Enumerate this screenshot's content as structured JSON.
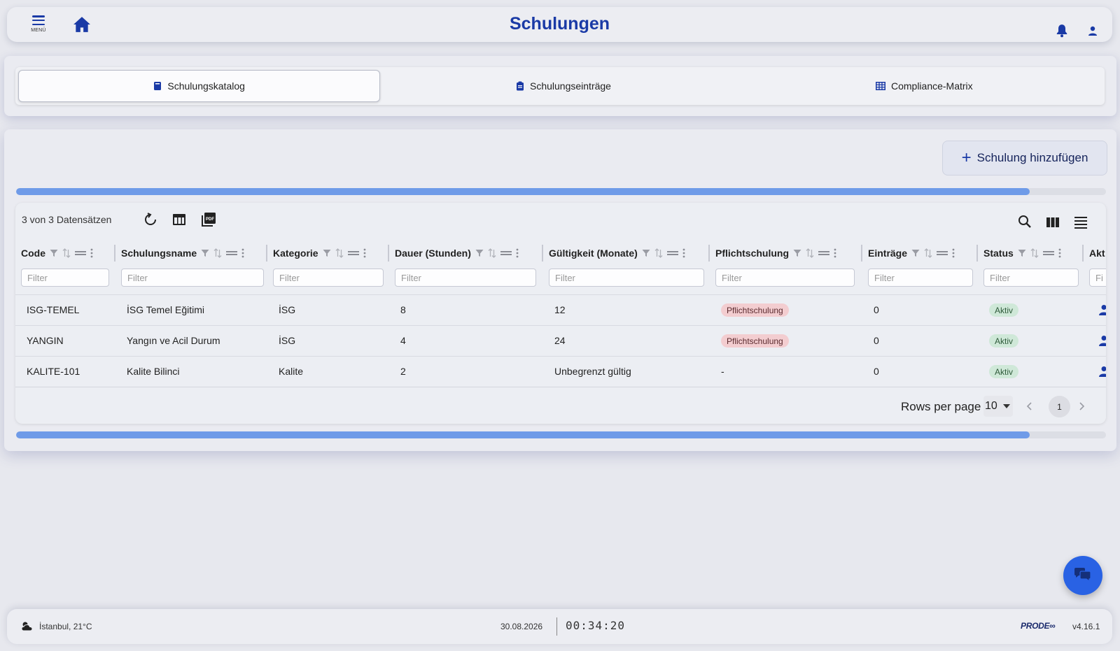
{
  "header": {
    "menu_label": "MENÜ",
    "title": "Schulungen"
  },
  "tabs": [
    {
      "label": "Schulungskatalog",
      "icon": "book-icon",
      "active": true
    },
    {
      "label": "Schulungseinträge",
      "icon": "clipboard-icon",
      "active": false
    },
    {
      "label": "Compliance-Matrix",
      "icon": "grid-icon",
      "active": false
    }
  ],
  "actions": {
    "add_label": "Schulung hinzufügen"
  },
  "progress": {
    "top_fill_pct": 93,
    "bottom_fill_pct": 93
  },
  "table": {
    "record_count": "3 von 3 Datensätzen",
    "columns": [
      {
        "label": "Code",
        "filter_placeholder": "Filter"
      },
      {
        "label": "Schulungsname",
        "filter_placeholder": "Filter"
      },
      {
        "label": "Kategorie",
        "filter_placeholder": "Filter"
      },
      {
        "label": "Dauer (Stunden)",
        "filter_placeholder": "Filter"
      },
      {
        "label": "Gültigkeit (Monate)",
        "filter_placeholder": "Filter"
      },
      {
        "label": "Pflichtschulung",
        "filter_placeholder": "Filter"
      },
      {
        "label": "Einträge",
        "filter_placeholder": "Filter"
      },
      {
        "label": "Status",
        "filter_placeholder": "Filter"
      },
      {
        "label": "Akt",
        "filter_placeholder": "Fi"
      }
    ],
    "rows": [
      {
        "code": "ISG-TEMEL",
        "name": "İSG Temel Eğitimi",
        "category": "İSG",
        "duration": "8",
        "validity": "12",
        "mandatory": "Pflichtschulung",
        "entries": "0",
        "status": "Aktiv"
      },
      {
        "code": "YANGIN",
        "name": "Yangın ve Acil Durum",
        "category": "İSG",
        "duration": "4",
        "validity": "24",
        "mandatory": "Pflichtschulung",
        "entries": "0",
        "status": "Aktiv"
      },
      {
        "code": "KALITE-101",
        "name": "Kalite Bilinci",
        "category": "Kalite",
        "duration": "2",
        "validity": "Unbegrenzt gültig",
        "mandatory": "-",
        "entries": "0",
        "status": "Aktiv"
      }
    ],
    "pagination": {
      "rows_per_page_label": "Rows per page",
      "rows_per_page": "10",
      "current_page": "1"
    }
  },
  "footer": {
    "weather": "İstanbul, 21°C",
    "date": "30.08.2026",
    "time": "00:34:20",
    "logo": "PRODE∞",
    "version": "v4.16.1"
  },
  "colors": {
    "primary": "#1a3aa6",
    "accent": "#2962e4",
    "progress": "#6f9be8",
    "chip_red": "#f3cdd0",
    "chip_green": "#cfe8d8"
  }
}
